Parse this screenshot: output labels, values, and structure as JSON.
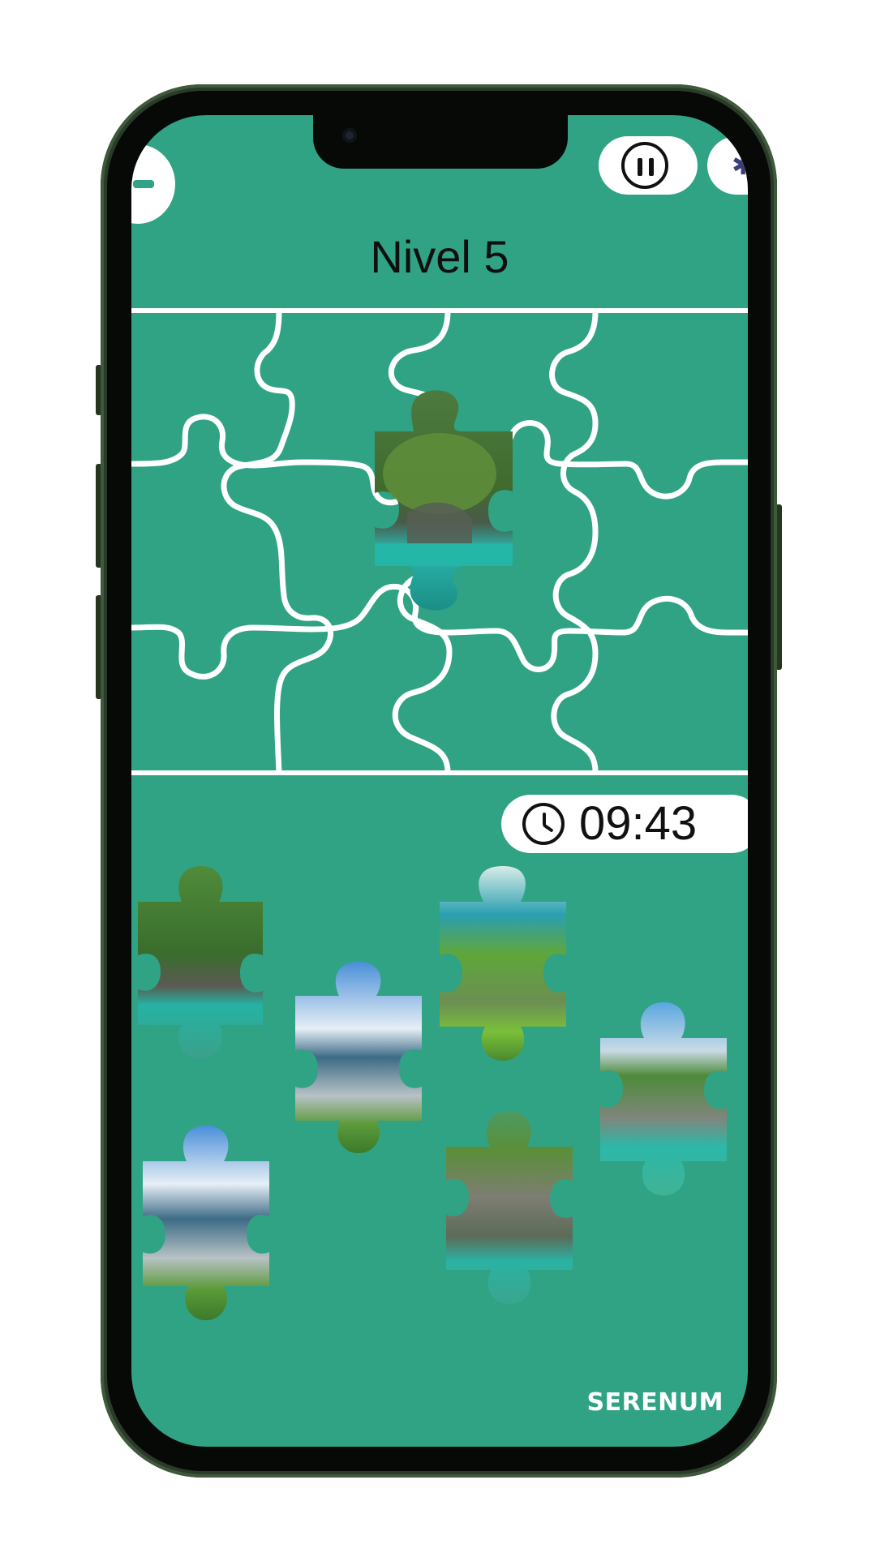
{
  "header": {
    "level_title": "Nivel 5",
    "back_icon": "back-icon",
    "pause_icon": "pause-icon",
    "settings_icon": "gear-icon"
  },
  "timer": {
    "icon": "clock-icon",
    "value": "09:43"
  },
  "brand": "SERENUM",
  "colors": {
    "screen_background": "#30a385",
    "board_lines": "#ffffff",
    "text": "#111111"
  }
}
